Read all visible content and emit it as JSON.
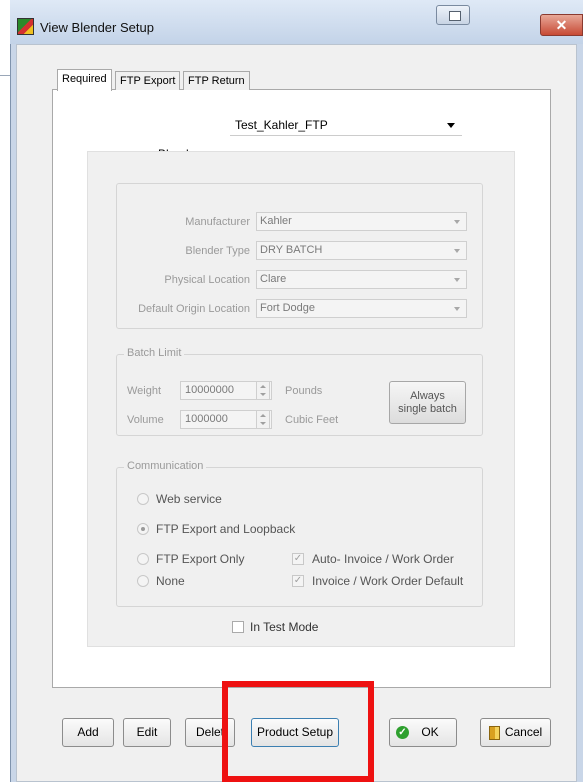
{
  "window": {
    "title": "View Blender Setup",
    "close_glyph": "✕",
    "title_icon": "blender-app-icon"
  },
  "tabs": [
    {
      "label": "Required",
      "selected": true
    },
    {
      "label": "FTP Export",
      "selected": false
    },
    {
      "label": "FTP Return",
      "selected": false
    }
  ],
  "blender": {
    "label": "Blender",
    "value": "Test_Kahler_FTP"
  },
  "details": {
    "manufacturer_label": "Manufacturer",
    "manufacturer_value": "Kahler",
    "blender_type_label": "Blender Type",
    "blender_type_value": "DRY BATCH",
    "physical_location_label": "Physical Location",
    "physical_location_value": "Clare",
    "default_origin_label": "Default Origin Location",
    "default_origin_value": "Fort Dodge"
  },
  "batch_limit": {
    "legend": "Batch Limit",
    "weight_label": "Weight",
    "weight_value": "10000000",
    "weight_unit": "Pounds",
    "volume_label": "Volume",
    "volume_value": "1000000",
    "volume_unit": "Cubic Feet",
    "always_button_line1": "Always",
    "always_button_line2": "single batch"
  },
  "communication": {
    "legend": "Communication",
    "options": [
      {
        "label": "Web service",
        "selected": false
      },
      {
        "label": "FTP Export and Loopback",
        "selected": true
      },
      {
        "label": "FTP Export Only",
        "selected": false
      },
      {
        "label": "None",
        "selected": false
      }
    ],
    "auto_invoice_label": "Auto- Invoice / Work Order",
    "auto_invoice_checked": true,
    "invoice_default_label": "Invoice / Work Order Default",
    "invoice_default_checked": true
  },
  "test_mode": {
    "label": "In Test Mode",
    "checked": false
  },
  "buttons": {
    "add": "Add",
    "edit": "Edit",
    "delete": "Delet",
    "product_setup": "Product Setup",
    "ok": "OK",
    "cancel": "Cancel"
  },
  "colors": {
    "highlight": "#ee1111",
    "ok_icon": "#2fa02f"
  }
}
